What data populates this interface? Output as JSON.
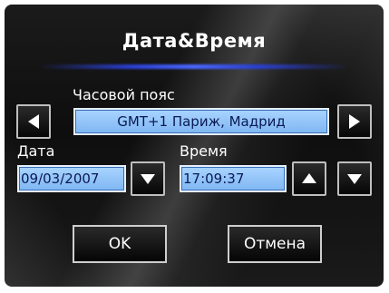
{
  "dialog": {
    "title": "Дата&Время"
  },
  "timezone": {
    "label": "Часовой пояс",
    "value": "GMT+1 Париж, Мадрид",
    "prev_icon": "triangle-left",
    "next_icon": "triangle-right"
  },
  "date": {
    "label": "Дата",
    "value": "09/03/2007",
    "dropdown_icon": "triangle-down"
  },
  "time": {
    "label": "Время",
    "value": "17:09:37",
    "up_icon": "triangle-up",
    "down_icon": "triangle-down"
  },
  "buttons": {
    "ok_label": "OK",
    "cancel_label": "Отмена"
  },
  "colors": {
    "field_fill": "#8fc2f8",
    "accent_line": "#3a55f0",
    "background": "#111111"
  }
}
